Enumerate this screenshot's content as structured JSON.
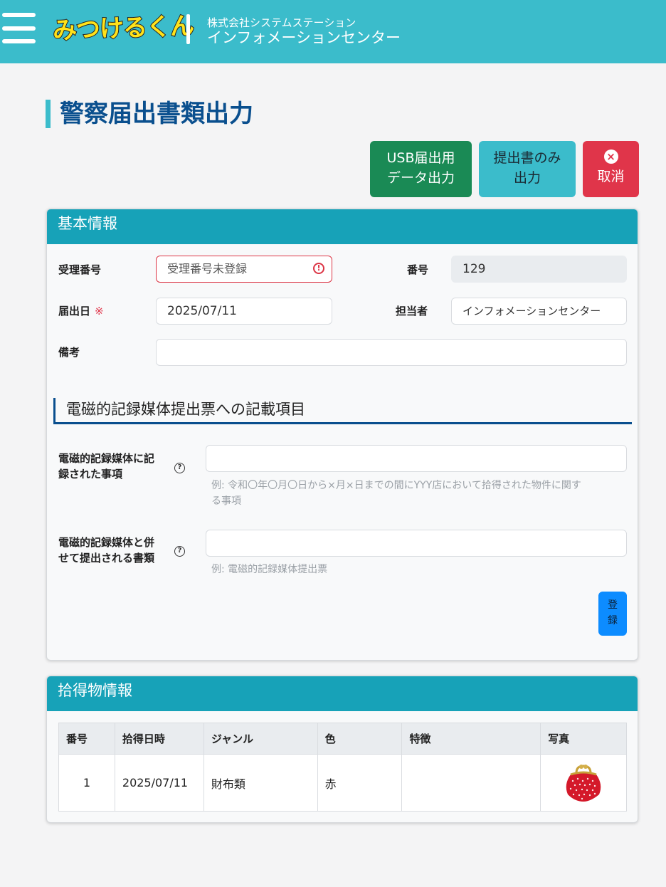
{
  "header": {
    "logo_text": "みつけるくん",
    "company_sub": "株式会社システムステーション",
    "company_main": "インフォメーションセンター"
  },
  "page": {
    "title": "警察届出書類出力"
  },
  "actions": {
    "usb_line1": "USB届出用",
    "usb_line2": "データ出力",
    "submit_line1": "提出書のみ",
    "submit_line2": "出力",
    "cancel_label": "取消"
  },
  "basic_info": {
    "header": "基本情報",
    "receipt_label": "受理番号",
    "receipt_placeholder": "受理番号未登録",
    "number_label": "番号",
    "number_value": "129",
    "date_label": "届出日",
    "date_required_mark": "※",
    "date_value": "2025/07/11",
    "staff_label": "担当者",
    "staff_value": "インフォメーションセンター",
    "notes_label": "備考",
    "notes_value": ""
  },
  "media_section": {
    "title": "電磁的記録媒体提出票への記載項目",
    "recorded_label_line1": "電磁的記録媒体に記",
    "recorded_label_line2": "録された事項",
    "recorded_value": "",
    "recorded_hint_line1": "例: 令和〇年〇月〇日から×月×日までの間にYYY店において拾得された物件に関す",
    "recorded_hint_line2": "る事項",
    "docs_label_line1": "電磁的記録媒体と併",
    "docs_label_line2": "せて提出される書類",
    "docs_value": "",
    "docs_hint": "例: 電磁的記録媒体提出票",
    "register_line1": "登",
    "register_line2": "録"
  },
  "found_items": {
    "header": "拾得物情報",
    "columns": [
      "番号",
      "拾得日時",
      "ジャンル",
      "色",
      "特徴",
      "写真"
    ],
    "rows": [
      {
        "no": "1",
        "date": "2025/07/11",
        "genre": "財布類",
        "color": "赤",
        "feature": "",
        "photo": "red-coin-purse-photo"
      }
    ]
  },
  "colors": {
    "topbar": "#3bbccb",
    "title_blue": "#0a4f8e",
    "usb_green": "#1a8a55",
    "cancel_red": "#e0354a",
    "card_header": "#17a2b8",
    "register_blue": "#0d8cff"
  },
  "icons": [
    "hamburger-menu-icon",
    "close-circle-icon",
    "invalid-exclamation-icon",
    "help-question-icon"
  ]
}
